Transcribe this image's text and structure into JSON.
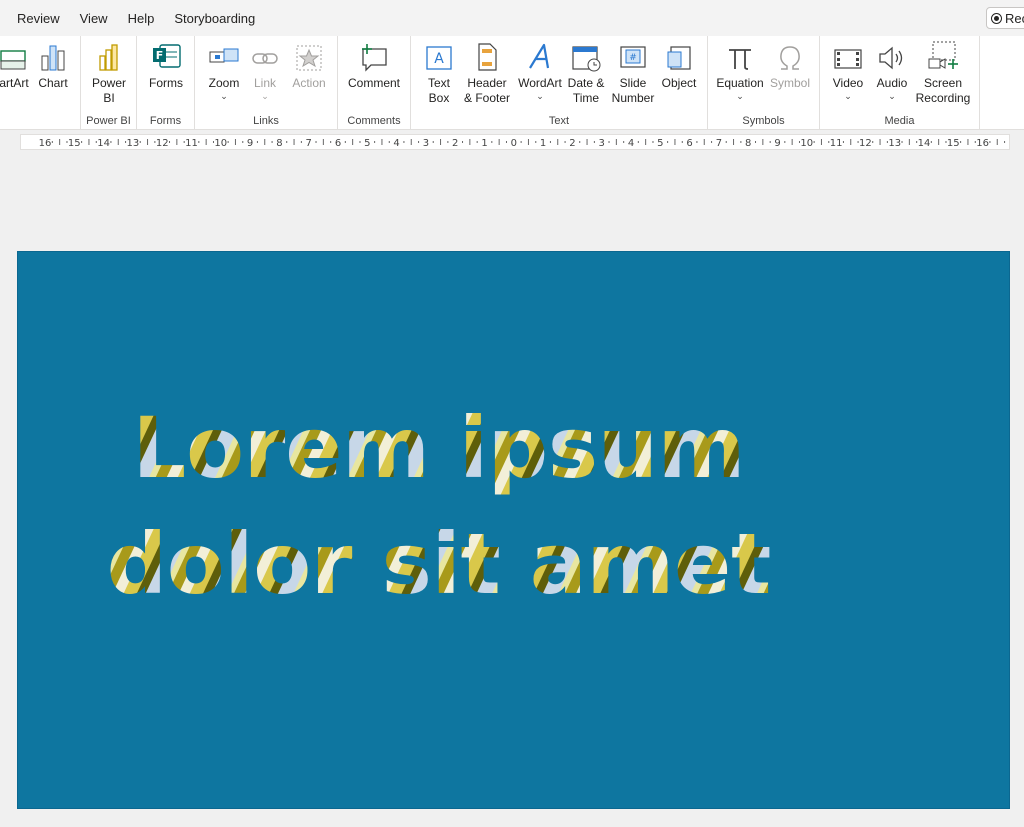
{
  "menu": {
    "items": [
      "Review",
      "View",
      "Help",
      "Storyboarding"
    ],
    "record_label": "Rec"
  },
  "ribbon": {
    "groups": {
      "charts": {
        "smartart": "artArt",
        "chart": "Chart"
      },
      "powerbi": {
        "label": "Power BI",
        "btn_line1": "Power",
        "btn_line2": "BI"
      },
      "forms": {
        "label": "Forms",
        "btn": "Forms"
      },
      "links": {
        "label": "Links",
        "zoom": "Zoom",
        "link": "Link",
        "action": "Action"
      },
      "comments": {
        "label": "Comments",
        "comment": "Comment"
      },
      "text": {
        "label": "Text",
        "textbox_1": "Text",
        "textbox_2": "Box",
        "header_1": "Header",
        "header_2": "& Footer",
        "wordart": "WordArt",
        "date_1": "Date &",
        "date_2": "Time",
        "slide_1": "Slide",
        "slide_2": "Number",
        "object": "Object"
      },
      "symbols": {
        "label": "Symbols",
        "equation": "Equation",
        "symbol": "Symbol"
      },
      "media": {
        "label": "Media",
        "video": "Video",
        "audio": "Audio",
        "screen_1": "Screen",
        "screen_2": "Recording"
      }
    }
  },
  "ruler": {
    "ticks": [
      "16",
      "15",
      "14",
      "13",
      "12",
      "11",
      "10",
      "9",
      "8",
      "7",
      "6",
      "5",
      "4",
      "3",
      "2",
      "1",
      "0",
      "1",
      "2",
      "3",
      "4",
      "5",
      "6",
      "7",
      "8",
      "9",
      "10",
      "11",
      "12",
      "13",
      "14",
      "15",
      "16"
    ]
  },
  "slide": {
    "line1": "Lorem ipsum",
    "line2": "dolor sit amet",
    "background": "#0e76a0"
  },
  "colors": {
    "ribbon_bg": "#ffffff",
    "app_bg": "#f0f0f0",
    "accent_blue": "#2b79d0",
    "green": "#107c41"
  }
}
